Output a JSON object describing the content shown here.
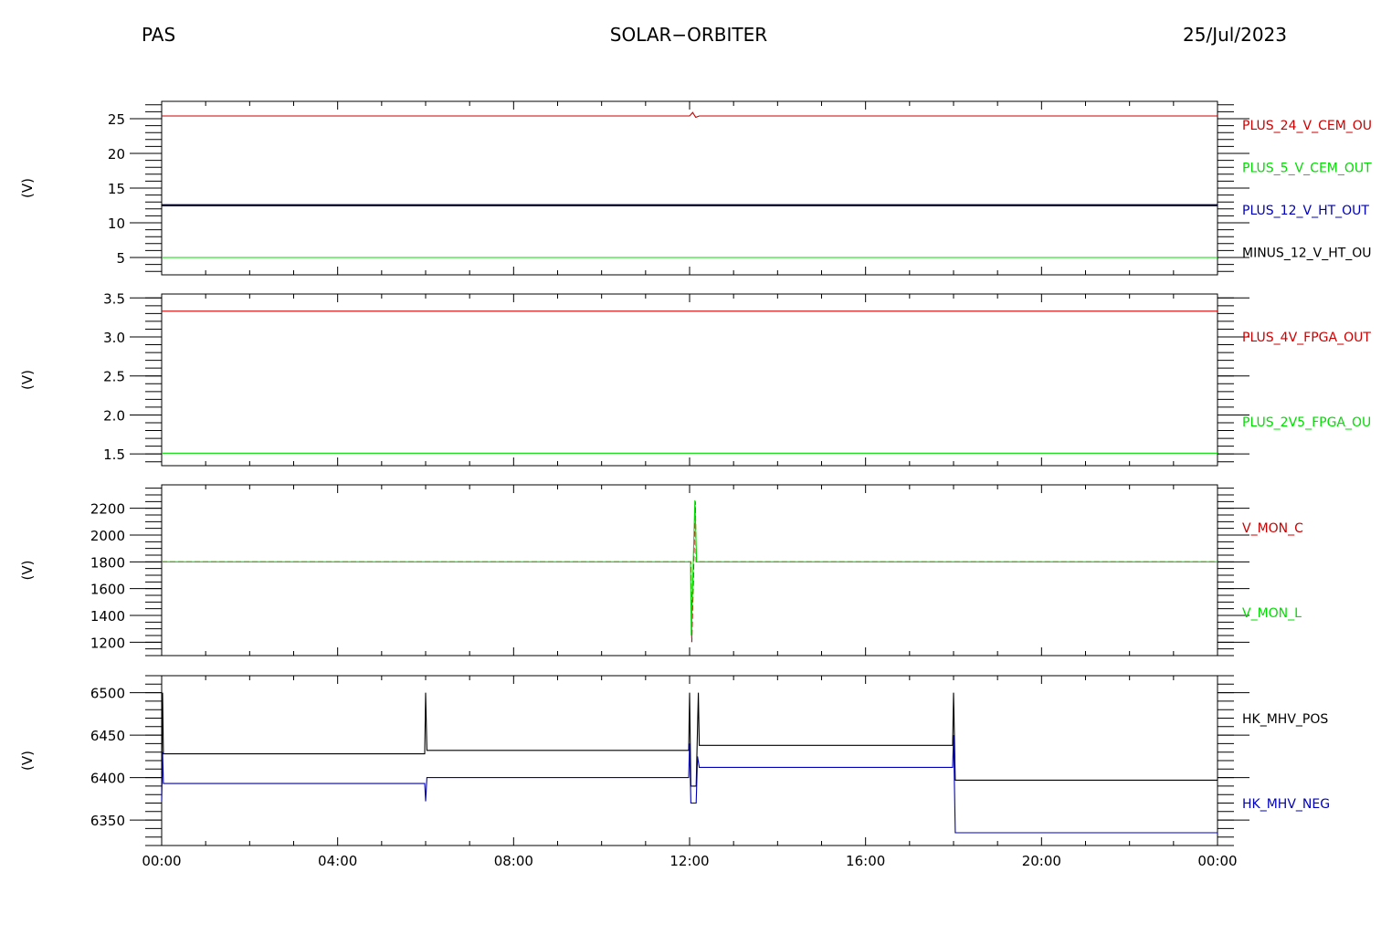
{
  "header": {
    "instrument": "PAS",
    "mission": "SOLAR−ORBITER",
    "date": "25/Jul/2023"
  },
  "colors": {
    "red": "#cc0000",
    "green": "#00dd00",
    "blue": "#0000bb",
    "black": "#000000"
  },
  "chart_data": [
    {
      "type": "line",
      "ylabel": "(V)",
      "ylim": [
        2.5,
        27.5
      ],
      "yticks": [
        5,
        10,
        15,
        20,
        25
      ],
      "ytick_labels": [
        "5",
        "10",
        "15",
        "20",
        "25"
      ],
      "minor_step": 1,
      "x_range_hours": [
        0,
        24
      ],
      "series": [
        {
          "name": "PLUS_24_V_CEM_OU",
          "color": "red",
          "points": [
            [
              0,
              25.4
            ],
            [
              12.0,
              25.4
            ],
            [
              12.07,
              25.9
            ],
            [
              12.14,
              25.2
            ],
            [
              12.22,
              25.4
            ],
            [
              24,
              25.4
            ]
          ]
        },
        {
          "name": "PLUS_5_V_CEM_OUT",
          "color": "green",
          "points": [
            [
              0,
              5.0
            ],
            [
              24,
              5.0
            ]
          ]
        },
        {
          "name": "PLUS_12_V_HT_OUT",
          "color": "blue",
          "thick": true,
          "points": [
            [
              0,
              12.5
            ],
            [
              24,
              12.5
            ]
          ]
        },
        {
          "name": "MINUS_12_V_HT_OU",
          "color": "black",
          "points": [
            [
              0,
              12.6
            ],
            [
              24,
              12.6
            ]
          ]
        }
      ]
    },
    {
      "type": "line",
      "ylabel": "(V)",
      "ylim": [
        1.35,
        3.55
      ],
      "yticks": [
        1.5,
        2.0,
        2.5,
        3.0,
        3.5
      ],
      "ytick_labels": [
        "1.5",
        "2.0",
        "2.5",
        "3.0",
        "3.5"
      ],
      "minor_step": 0.1,
      "x_range_hours": [
        0,
        24
      ],
      "series": [
        {
          "name": "PLUS_4V_FPGA_OUT",
          "color": "red",
          "points": [
            [
              0,
              3.33
            ],
            [
              24,
              3.33
            ]
          ]
        },
        {
          "name": "PLUS_2V5_FPGA_OU",
          "color": "green",
          "points": [
            [
              0,
              1.51
            ],
            [
              24,
              1.51
            ]
          ]
        }
      ]
    },
    {
      "type": "line",
      "ylabel": "(V)",
      "ylim": [
        1100,
        2375
      ],
      "yticks": [
        1200,
        1400,
        1600,
        1800,
        2000,
        2200
      ],
      "ytick_labels": [
        "1200",
        "1400",
        "1600",
        "1800",
        "2000",
        "2200"
      ],
      "minor_step": 50,
      "x_range_hours": [
        0,
        24
      ],
      "series": [
        {
          "name": "V_MON_C",
          "color": "red",
          "dashed": true,
          "points": [
            [
              0,
              1800
            ],
            [
              12.03,
              1800
            ],
            [
              12.05,
              1200
            ],
            [
              12.13,
              2250
            ],
            [
              12.15,
              1800
            ],
            [
              24,
              1800
            ]
          ]
        },
        {
          "name": "V_MON_L",
          "color": "green",
          "points": [
            [
              0,
              1800
            ],
            [
              12.02,
              1800
            ],
            [
              12.04,
              1250
            ],
            [
              12.12,
              2260
            ],
            [
              12.16,
              1800
            ],
            [
              24,
              1800
            ]
          ]
        }
      ]
    },
    {
      "type": "line",
      "ylabel": "(V)",
      "ylim": [
        6320,
        6520
      ],
      "yticks": [
        6350,
        6400,
        6450,
        6500
      ],
      "ytick_labels": [
        "6350",
        "6400",
        "6450",
        "6500"
      ],
      "minor_step": 10,
      "x_range_hours": [
        0,
        24
      ],
      "xticks": [
        0,
        4,
        8,
        12,
        16,
        20,
        24
      ],
      "xtick_labels": [
        "00:00",
        "04:00",
        "08:00",
        "12:00",
        "16:00",
        "20:00",
        "00:00"
      ],
      "series": [
        {
          "name": "HK_MHV_POS",
          "color": "black",
          "points": [
            [
              0,
              6405
            ],
            [
              0.02,
              6500
            ],
            [
              0.04,
              6428
            ],
            [
              5.98,
              6428
            ],
            [
              6.0,
              6500
            ],
            [
              6.03,
              6432
            ],
            [
              11.98,
              6432
            ],
            [
              12.0,
              6500
            ],
            [
              12.03,
              6390
            ],
            [
              12.15,
              6390
            ],
            [
              12.2,
              6500
            ],
            [
              12.22,
              6438
            ],
            [
              17.98,
              6438
            ],
            [
              18.0,
              6500
            ],
            [
              18.04,
              6397
            ],
            [
              24,
              6397
            ]
          ]
        },
        {
          "name": "HK_MHV_NEG",
          "color": "blue",
          "points": [
            [
              0,
              6372
            ],
            [
              0.02,
              6430
            ],
            [
              0.04,
              6393
            ],
            [
              5.98,
              6393
            ],
            [
              6.0,
              6372
            ],
            [
              6.03,
              6400
            ],
            [
              11.98,
              6400
            ],
            [
              12.0,
              6440
            ],
            [
              12.03,
              6370
            ],
            [
              12.15,
              6370
            ],
            [
              12.18,
              6425
            ],
            [
              12.22,
              6412
            ],
            [
              17.98,
              6412
            ],
            [
              18.0,
              6450
            ],
            [
              18.04,
              6335
            ],
            [
              24,
              6335
            ]
          ]
        }
      ]
    }
  ]
}
